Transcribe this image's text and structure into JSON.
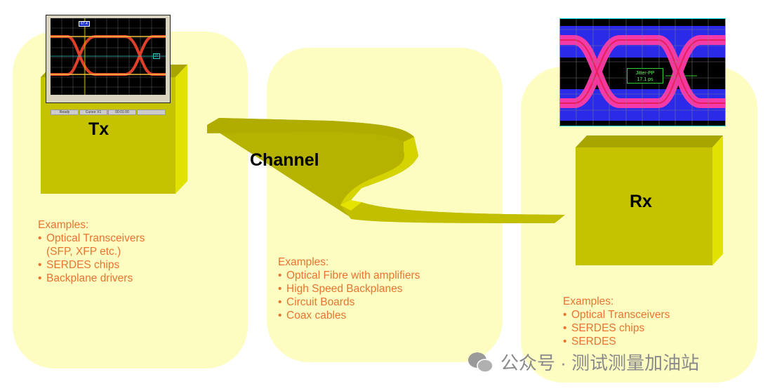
{
  "tx": {
    "label": "Tx",
    "examples_title": "Examples:",
    "examples": [
      "Optical Transceivers",
      "(SFP, XFP etc.)",
      "SERDES chips",
      "Backplane drivers"
    ],
    "scope": {
      "marker_value": "67.4",
      "level_value": "20",
      "status": [
        "Ready",
        "Cursor X1",
        "00:01:00",
        ""
      ]
    }
  },
  "channel": {
    "label": "Channel",
    "examples_title": "Examples:",
    "examples": [
      "Optical Fibre with amplifiers",
      "High Speed Backplanes",
      "Circuit Boards",
      "Coax cables"
    ]
  },
  "rx": {
    "label": "Rx",
    "examples_title": "Examples:",
    "examples": [
      "Optical Transceivers",
      "SERDES chips",
      "SERDES"
    ],
    "scope": {
      "measure_label": "Jitter-PP",
      "measure_value": "17.1 ps"
    }
  },
  "watermark": "公众号 · 测试测量加油站",
  "colors": {
    "panel": "#fdfdc2",
    "cube_front": "#c5c200",
    "cube_side": "#e2e200",
    "text": "#ea7330"
  }
}
